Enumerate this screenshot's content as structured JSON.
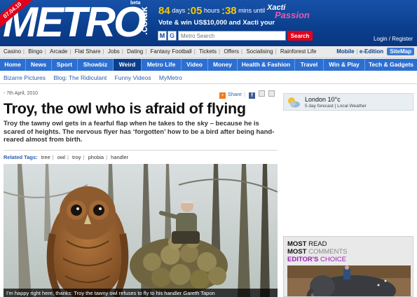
{
  "header": {
    "logo_text": "METRO",
    "logo_suffix": ".co.uk",
    "beta_label": "beta",
    "date_ribbon": "07.04.10",
    "brand_color": "#0b3f8e",
    "accent_color": "#e2001a",
    "promo": {
      "days_value": "84",
      "days_label": "days",
      "hours_value": ":05",
      "hours_label": "hours",
      "mins_value": ":38",
      "mins_label": "mins until",
      "brand": "Xacti",
      "brand_tagline": "Passion",
      "vote_text": "Vote & win US$10,000 and Xacti your"
    },
    "search": {
      "m_icon": "M",
      "g_icon": "G",
      "placeholder": "Metro Search",
      "button_label": "Search"
    },
    "login_text": "Login / Register"
  },
  "subnav": {
    "items": [
      "Casino",
      "Bingo",
      "Arcade",
      "Flat Share",
      "Jobs",
      "Dating",
      "Fantasy Football",
      "Tickets",
      "Offers",
      "Socialising",
      "Rainforest Life"
    ],
    "mobile_label": "Mobile",
    "edition_label": "e-Edition",
    "sitemap_label": "SiteMap"
  },
  "mainnav": {
    "tabs": [
      "Home",
      "News",
      "Sport",
      "Showbiz",
      "Weird",
      "Metro Life",
      "Video",
      "Money",
      "Health & Fashion",
      "Travel",
      "Win & Play",
      "Tech & Gadgets"
    ],
    "active": "Weird",
    "color": "#2c6fd1"
  },
  "section_nav": {
    "items": [
      "Bizarre Pictures",
      "Blog: The Ridiculant",
      "Funny Videos",
      "MyMetro"
    ]
  },
  "article": {
    "date": "- 7th April, 2010",
    "share_label": "Share",
    "headline": "Troy, the owl who is afraid of flying",
    "standfirst": "Troy the tawny owl gets in a fearful flap when he takes to the sky – because he is scared of heights. The nervous flyer has ‘forgotten’ how to be a bird after being hand-reared almost from birth.",
    "tags_label": "Related Tags:",
    "tags": [
      "tree",
      "owl",
      "troy",
      "phobia",
      "handler"
    ],
    "caption": "I'm happy right here, thanks: Troy the tawny owl refuses to fly to his handler Gareth Tapon"
  },
  "sidebar": {
    "weather": {
      "city": "London 10°c",
      "forecast": "5 day forecast",
      "local": "Local Weather"
    },
    "most": {
      "read_a": "MOST",
      "read_b": "READ",
      "comments_a": "MOST",
      "comments_b": "COMMENTS",
      "choice_a": "EDITOR'S",
      "choice_b": "CHOICE",
      "choice_color": "#9b1fb5"
    }
  }
}
